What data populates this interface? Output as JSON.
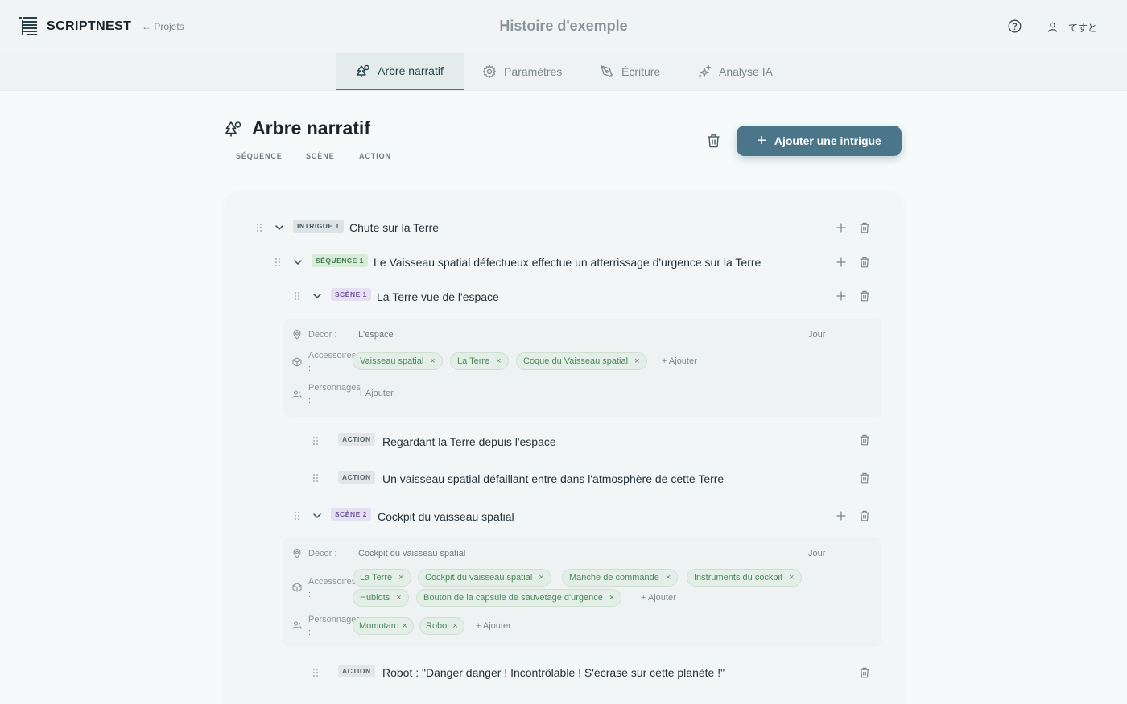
{
  "header": {
    "brand": "SCRIPTNEST",
    "back_link": "← Projets",
    "story_title": "Histoire d'exemple",
    "user_name": "てすと"
  },
  "tabs": [
    {
      "label": "Arbre narratif",
      "icon": "tree-icon",
      "active": true
    },
    {
      "label": "Paramètres",
      "icon": "gear-icon",
      "active": false
    },
    {
      "label": "Écriture",
      "icon": "pen-icon",
      "active": false
    },
    {
      "label": "Analyse IA",
      "icon": "sparkle-icon",
      "active": false
    }
  ],
  "page": {
    "title": "Arbre narratif",
    "legend": [
      "SÉQUENCE",
      "SCÈNE",
      "ACTION"
    ],
    "add_plot_label": "Ajouter une intrigue"
  },
  "tree": {
    "intrigue": {
      "badge": "INTRIGUE 1",
      "title": "Chute sur la Terre"
    },
    "sequence": {
      "badge": "SÉQUENCE 1",
      "title": "Le Vaisseau spatial défectueux effectue un atterrissage d'urgence sur la Terre"
    },
    "scene1": {
      "badge": "SCÈNE 1",
      "title": "La Terre vue de l'espace",
      "decor_label": "Décor :",
      "decor": "L'espace",
      "time": "Jour",
      "props_label": "Accessoires :",
      "props": [
        "Vaisseau spatial",
        "La Terre",
        "Coque du Vaisseau spatial"
      ],
      "chars_label": "Personnages :",
      "characters": [],
      "add_label": "+ Ajouter"
    },
    "actions1": [
      {
        "badge": "ACTION",
        "text": "Regardant la Terre depuis l'espace"
      },
      {
        "badge": "ACTION",
        "text": "Un vaisseau spatial défaillant entre dans l'atmosphère de cette Terre"
      }
    ],
    "scene2": {
      "badge": "SCÈNE 2",
      "title": "Cockpit du vaisseau spatial",
      "decor_label": "Décor :",
      "decor": "Cockpit du vaisseau spatial",
      "time": "Jour",
      "props_label": "Accessoires :",
      "props": [
        "La Terre",
        "Cockpit du vaisseau spatial",
        "Manche de commande",
        "Instruments du cockpit",
        "Hublots",
        "Bouton de la capsule de sauvetage d'urgence"
      ],
      "chars_label": "Personnages :",
      "characters": [
        "Momotaro",
        "Robot"
      ],
      "add_label": "+ Ajouter"
    },
    "actions2": [
      {
        "badge": "ACTION",
        "text": "Robot : \"Danger danger ! Incontrôlable ! S'écrase sur cette planète !\""
      }
    ]
  }
}
